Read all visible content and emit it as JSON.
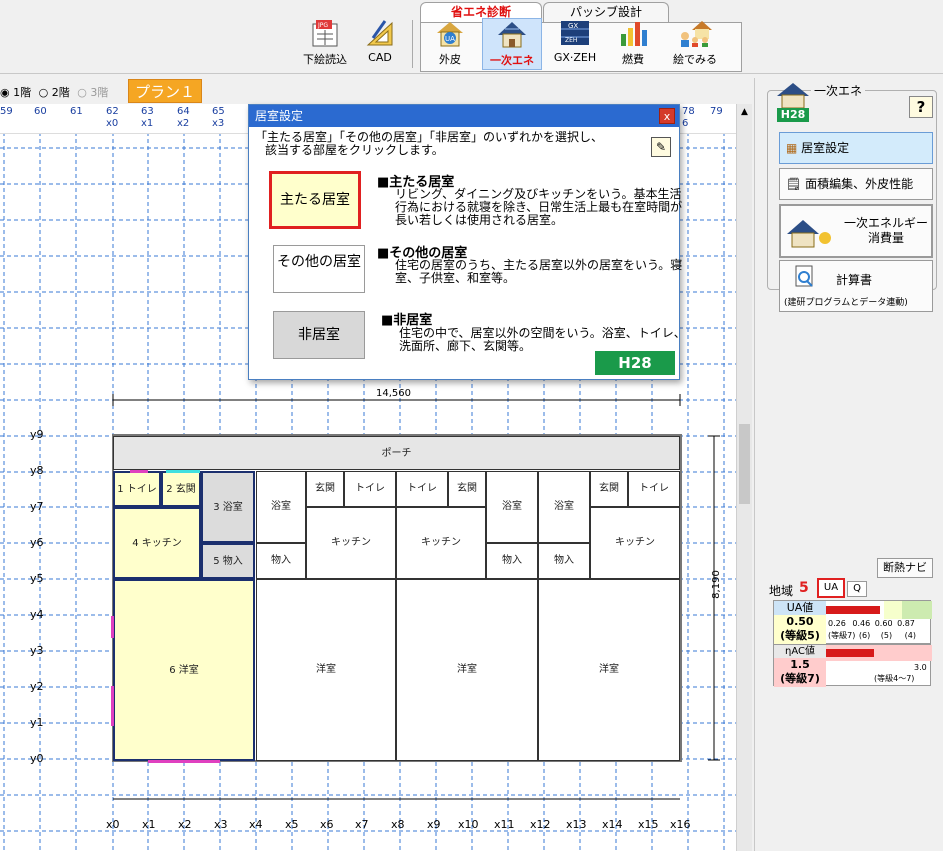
{
  "toolbar": {
    "left_buttons": [
      {
        "label": "下絵読込",
        "icon": "trace-image-icon"
      },
      {
        "label": "CAD",
        "icon": "cad-ruler-icon"
      }
    ],
    "tabs": [
      {
        "label": "省エネ診断",
        "active": true
      },
      {
        "label": "パッシブ設計",
        "active": false
      }
    ],
    "tab_buttons": [
      {
        "label": "外皮",
        "icon": "house-ua-icon"
      },
      {
        "label": "一次エネ",
        "icon": "solar-house-icon"
      },
      {
        "label": "GX·ZEH",
        "icon": "gx-zeh-panel-icon"
      },
      {
        "label": "燃費",
        "icon": "bar-chart-icon"
      },
      {
        "label": "絵でみる",
        "icon": "family-house-icon"
      }
    ]
  },
  "floor_selector": {
    "options": [
      "1階",
      "2階",
      "3階"
    ],
    "selected": "1階",
    "plan_label": "プラン１"
  },
  "ruler_top": [
    "59",
    "60",
    "61",
    "62",
    "63",
    "64",
    "65",
    "78",
    "79"
  ],
  "ruler_top_x": [
    "x0",
    "x1",
    "x2",
    "x3",
    "6"
  ],
  "grid_bottom": [
    "x0",
    "x1",
    "x2",
    "x3",
    "x4",
    "x5",
    "x6",
    "x7",
    "x8",
    "x9",
    "x10",
    "x11",
    "x12",
    "x13",
    "x14",
    "x15",
    "x16"
  ],
  "grid_left": [
    "y9",
    "y8",
    "y7",
    "y6",
    "y5",
    "y4",
    "y3",
    "y2",
    "y1",
    "y0"
  ],
  "dimensions": {
    "width": "14,560",
    "height": "8,190"
  },
  "rooms": {
    "porch": "ポーチ",
    "toilet1": "1 トイレ",
    "entrance2": "2 玄関",
    "bath3": "3 浴室",
    "kitchen4": "4 キッチン",
    "storage5": "5 物入",
    "western6": "6 洋室",
    "other_bath": "浴室",
    "other_entrance": "玄関",
    "other_toilet": "トイレ",
    "other_kitchen": "キッチン",
    "other_storage": "物入",
    "other_western": "洋室"
  },
  "dialog": {
    "title": "居室設定",
    "close": "x",
    "instruction_line1": "「主たる居室」「その他の居室」「非居室」のいずれかを選択し、",
    "instruction_line2": "該当する部屋をクリックします。",
    "badge": "H28",
    "options": [
      {
        "button": "主たる居室",
        "heading": "■主たる居室",
        "desc": "リビング、ダイニング及びキッチンをいう。基本生活行為における就寝を除き、日常生活上最も在室時間が長い若しくは使用される居室。",
        "selected": true
      },
      {
        "button": "その他の居室",
        "heading": "■その他の居室",
        "desc": "住宅の居室のうち、主たる居室以外の居室をいう。寝室、子供室、和室等。",
        "selected": false
      },
      {
        "button": "非居室",
        "heading": "■非居室",
        "desc": "住宅の中で、居室以外の空間をいう。浴室、トイレ、洗面所、廊下、玄関等。",
        "selected": false
      }
    ]
  },
  "right_panel": {
    "group_title": "一次エネ",
    "help": "?",
    "badge": "H28",
    "buttons": [
      {
        "label": "居室設定",
        "icon": "room-grid-icon",
        "active": true
      },
      {
        "label": "面積編集、外皮性能",
        "icon": "area-edit-icon",
        "active": false
      },
      {
        "label": "一次エネルギー消費量",
        "line1": "一次エネルギー",
        "line2": "消費量",
        "icon": "solar-house-icon",
        "active": false
      },
      {
        "label": "計算書",
        "sub": "(建研プログラムとデータ連動)",
        "icon": "report-search-icon",
        "active": false
      }
    ],
    "navi_button": "断熱ナビ",
    "region_label": "地域",
    "region_value": "5",
    "mode_ua": "UA",
    "mode_q": "Q",
    "ua": {
      "title": "UA値",
      "value": "0.50",
      "grade": "(等級5)",
      "scale": [
        "0.26",
        "0.46",
        "0.60",
        "0.87"
      ],
      "scale_labels": [
        "(等級7)",
        "(6)",
        "(5)",
        "(4)"
      ]
    },
    "eta": {
      "title": "ηAC値",
      "value": "1.5",
      "grade": "(等級7)",
      "max": "3.0",
      "range": "(等級4〜7)"
    }
  },
  "colors": {
    "accent_orange": "#f5a623",
    "dialog_title": "#2b6ad0",
    "selected_border": "#e02020",
    "h28_green": "#1a9a4a",
    "room_fill": "#ffffcc",
    "room_grey": "#dcdcdc",
    "grid_blue": "#3a78d4"
  }
}
